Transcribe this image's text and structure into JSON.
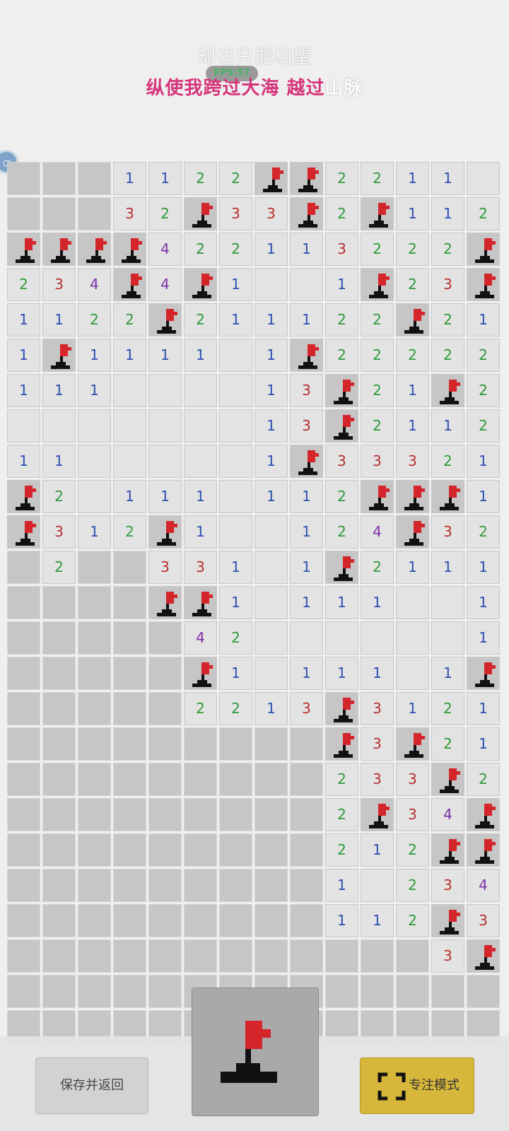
{
  "overlay": {
    "lyric_prev": "却也只能相望",
    "lyric_current_highlighted": "纵使我跨过大海 越过",
    "lyric_current_rest": "山脉",
    "fps_label": "FPS:57"
  },
  "colors": {
    "n1": "#2c4fb0",
    "n2": "#2e9a3c",
    "n3": "#b82f2f",
    "n4": "#7b2fa8",
    "flag_red": "#d4252b",
    "flag_base": "#111111",
    "focus_button": "#d7b73b",
    "lyric_highlight": "#d6337a"
  },
  "board": {
    "columns": 14,
    "legend": "H = hidden tile, F = flagged tile, . = opened empty tile, 1-8 = adjacent mine count",
    "rows": [
      "HHH1122FF2211.1",
      "HHH32F33F2F112",
      "FFFF422113222F",
      "234F4F1..1F23F",
      "1122F211122F21",
      "1F1111.1F22222",
      "111....13F21F2",
      ".......13F2112",
      "11.....1F33321",
      "F2.111.112FFF1",
      "F312F1..124F32",
      "H2HH331.1F2111",
      "HHHHFF1.111..1",
      "HHHHH42......11",
      "HHHHHF1.111.1F",
      "HHHHH2213F3121",
      "HHHHHHHHHF3F21",
      "HHHHHHHHH233F2",
      "HHHHHHHHH2F34F",
      "HHHHHHHHH212FF",
      "HHHHHHHHH1.234",
      "HHHHHHHHH112F3",
      "HHHHHHHHHHHH3F",
      "HHHHHHHHHHHHHH",
      "HHHHHHHHHHHHHH"
    ]
  },
  "controls": {
    "save_return_label": "保存并返回",
    "flag_mode_icon": "flag-icon",
    "focus_mode_label": "专注模式",
    "focus_mode_icon": "fullscreen-corners-icon"
  }
}
